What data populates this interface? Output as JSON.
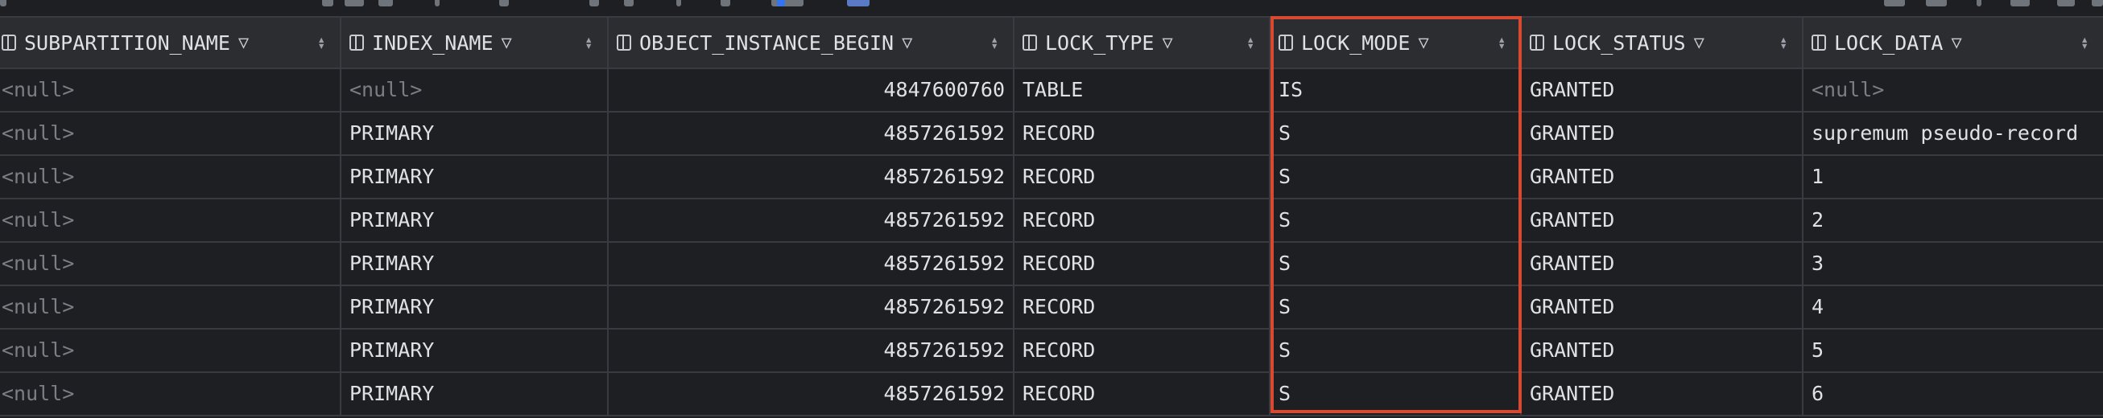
{
  "columns": [
    {
      "name": "SUBPARTITION_NAME"
    },
    {
      "name": "INDEX_NAME"
    },
    {
      "name": "OBJECT_INSTANCE_BEGIN"
    },
    {
      "name": "LOCK_TYPE"
    },
    {
      "name": "LOCK_MODE"
    },
    {
      "name": "LOCK_STATUS"
    },
    {
      "name": "LOCK_DATA"
    }
  ],
  "rows": [
    [
      "<null>",
      "<null>",
      "4847600760",
      "TABLE",
      "IS",
      "GRANTED",
      "<null>"
    ],
    [
      "<null>",
      "PRIMARY",
      "4857261592",
      "RECORD",
      "S",
      "GRANTED",
      "supremum pseudo-record"
    ],
    [
      "<null>",
      "PRIMARY",
      "4857261592",
      "RECORD",
      "S",
      "GRANTED",
      "1"
    ],
    [
      "<null>",
      "PRIMARY",
      "4857261592",
      "RECORD",
      "S",
      "GRANTED",
      "2"
    ],
    [
      "<null>",
      "PRIMARY",
      "4857261592",
      "RECORD",
      "S",
      "GRANTED",
      "3"
    ],
    [
      "<null>",
      "PRIMARY",
      "4857261592",
      "RECORD",
      "S",
      "GRANTED",
      "4"
    ],
    [
      "<null>",
      "PRIMARY",
      "4857261592",
      "RECORD",
      "S",
      "GRANTED",
      "5"
    ],
    [
      "<null>",
      "PRIMARY",
      "4857261592",
      "RECORD",
      "S",
      "GRANTED",
      "6"
    ]
  ],
  "highlighted_column": "LOCK_MODE",
  "colors": {
    "background": "#1e1f22",
    "header": "#2b2d30",
    "grid_line": "#393b40",
    "highlight": "#d84a2f",
    "null_text": "#7a7e85"
  }
}
